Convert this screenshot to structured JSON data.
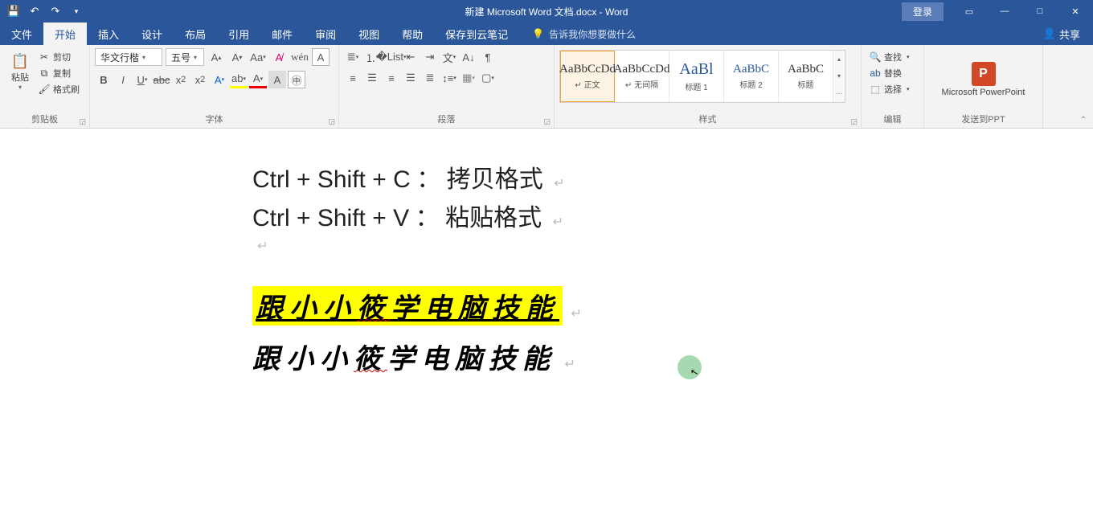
{
  "title": "新建 Microsoft Word 文档.docx  -  Word",
  "login": "登录",
  "menu": {
    "file": "文件",
    "tabs": [
      "开始",
      "插入",
      "设计",
      "布局",
      "引用",
      "邮件",
      "审阅",
      "视图",
      "帮助",
      "保存到云笔记"
    ],
    "active": "开始",
    "tellme_placeholder": "告诉我你想要做什么",
    "share": "共享"
  },
  "clipboard": {
    "paste": "粘贴",
    "cut": "剪切",
    "copy": "复制",
    "painter": "格式刷",
    "label": "剪贴板"
  },
  "font": {
    "name": "华文行楷",
    "size": "五号",
    "label": "字体"
  },
  "paragraph": {
    "label": "段落"
  },
  "styles": {
    "items": [
      {
        "preview": "AaBbCcDd",
        "name": "↵ 正文"
      },
      {
        "preview": "AaBbCcDd",
        "name": "↵ 无间隔"
      },
      {
        "preview": "AaBl",
        "name": "标题 1"
      },
      {
        "preview": "AaBbC",
        "name": "标题 2"
      },
      {
        "preview": "AaBbC",
        "name": "标题"
      }
    ],
    "label": "样式"
  },
  "editing": {
    "find": "查找",
    "replace": "替换",
    "select": "选择",
    "label": "编辑"
  },
  "ppt": {
    "title": "Microsoft PowerPoint",
    "label": "发送到PPT"
  },
  "doc": {
    "line1_a": "Ctrl + Shift + C",
    "line1_b": "：",
    "line1_c": "拷贝格式",
    "line2_a": "Ctrl + Shift + V",
    "line2_b": "：",
    "line2_c": "粘贴格式",
    "hl_a": "跟小小",
    "hl_sq": "筱",
    "hl_b": "学电脑技能",
    "pl_a": "跟小小",
    "pl_sq": "筱",
    "pl_b": "学电脑技能"
  }
}
